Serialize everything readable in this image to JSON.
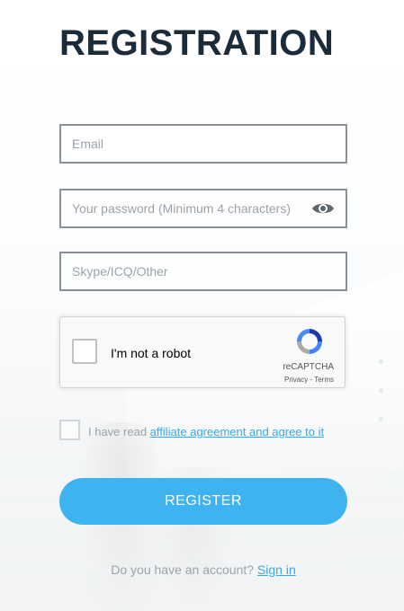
{
  "page": {
    "title": "REGISTRATION"
  },
  "form": {
    "email": {
      "placeholder": "Email",
      "value": ""
    },
    "password": {
      "placeholder": "Your password (Minimum 4 characters)",
      "value": "",
      "icon": "eye-icon"
    },
    "messenger": {
      "placeholder": "Skype/ICQ/Other",
      "value": ""
    }
  },
  "recaptcha": {
    "label": "I'm not a robot",
    "brand": "reCAPTCHA",
    "terms": "Privacy - Terms",
    "checked": false
  },
  "agreement": {
    "prefix": "I have read ",
    "link_text": "affiliate agreement and agree to it",
    "checked": false
  },
  "register_button": {
    "label": "REGISTER"
  },
  "signin": {
    "prompt": "Do you have an account? ",
    "link_text": "Sign in"
  },
  "colors": {
    "accent": "#3fb2f0",
    "link": "#36a9e6",
    "title": "#1b2b3a",
    "field_border": "#8a9099"
  }
}
